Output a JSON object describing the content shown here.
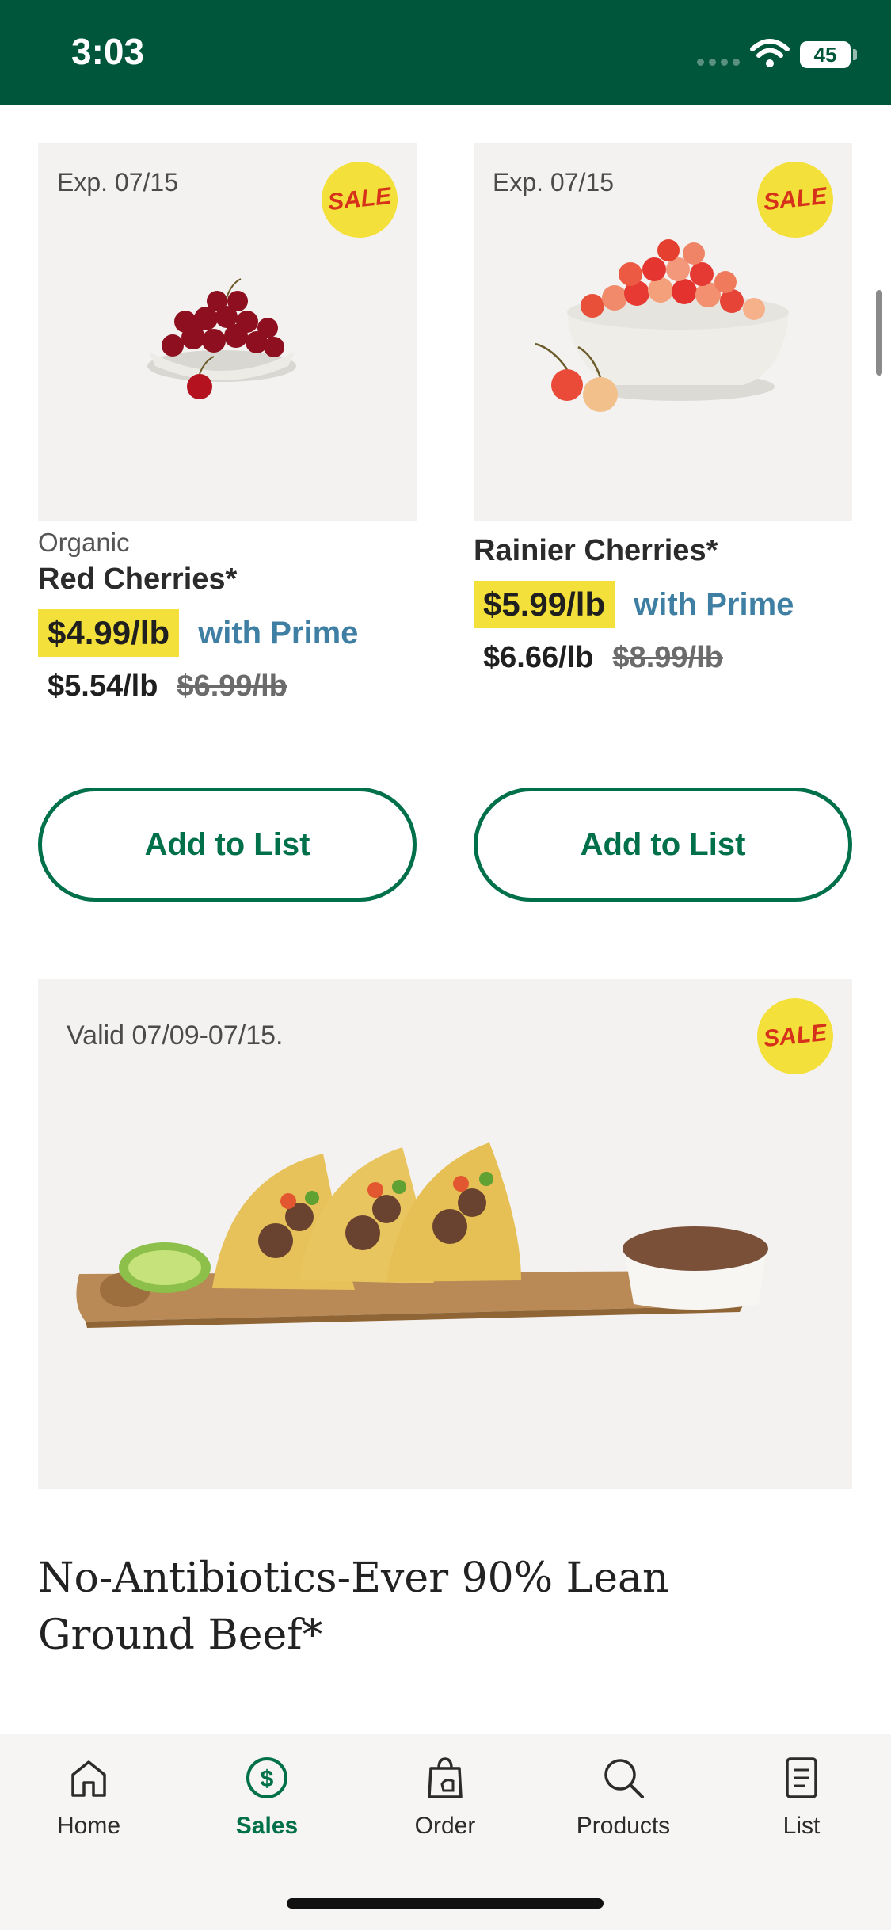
{
  "status_bar": {
    "time": "3:03",
    "battery": "45"
  },
  "products": [
    {
      "exp": "Exp. 07/15",
      "badge": "SALE",
      "brand": "Organic",
      "name": "Red Cherries*",
      "prime_price": "$4.99/lb",
      "prime_text": "with Prime",
      "sale_price": "$5.54/lb",
      "regular_price": "$6.99/lb",
      "button": "Add to List"
    },
    {
      "exp": "Exp. 07/15",
      "badge": "SALE",
      "brand": "",
      "name": "Rainier Cherries*",
      "prime_price": "$5.99/lb",
      "prime_text": "with Prime",
      "sale_price": "$6.66/lb",
      "regular_price": "$8.99/lb",
      "button": "Add to List"
    }
  ],
  "feature": {
    "valid": "Valid 07/09-07/15.",
    "badge": "SALE",
    "title": "No-Antibiotics-Ever 90% Lean Ground Beef*"
  },
  "nav": [
    {
      "label": "Home",
      "icon": "home-icon",
      "active": false
    },
    {
      "label": "Sales",
      "icon": "dollar-circle-icon",
      "active": true
    },
    {
      "label": "Order",
      "icon": "shopping-bag-icon",
      "active": false
    },
    {
      "label": "Products",
      "icon": "search-icon",
      "active": false
    },
    {
      "label": "List",
      "icon": "list-icon",
      "active": false
    }
  ],
  "colors": {
    "brand_green": "#00563a",
    "accent_green": "#00704a",
    "sale_yellow": "#f4e03a",
    "prime_blue": "#3f7fa3"
  }
}
